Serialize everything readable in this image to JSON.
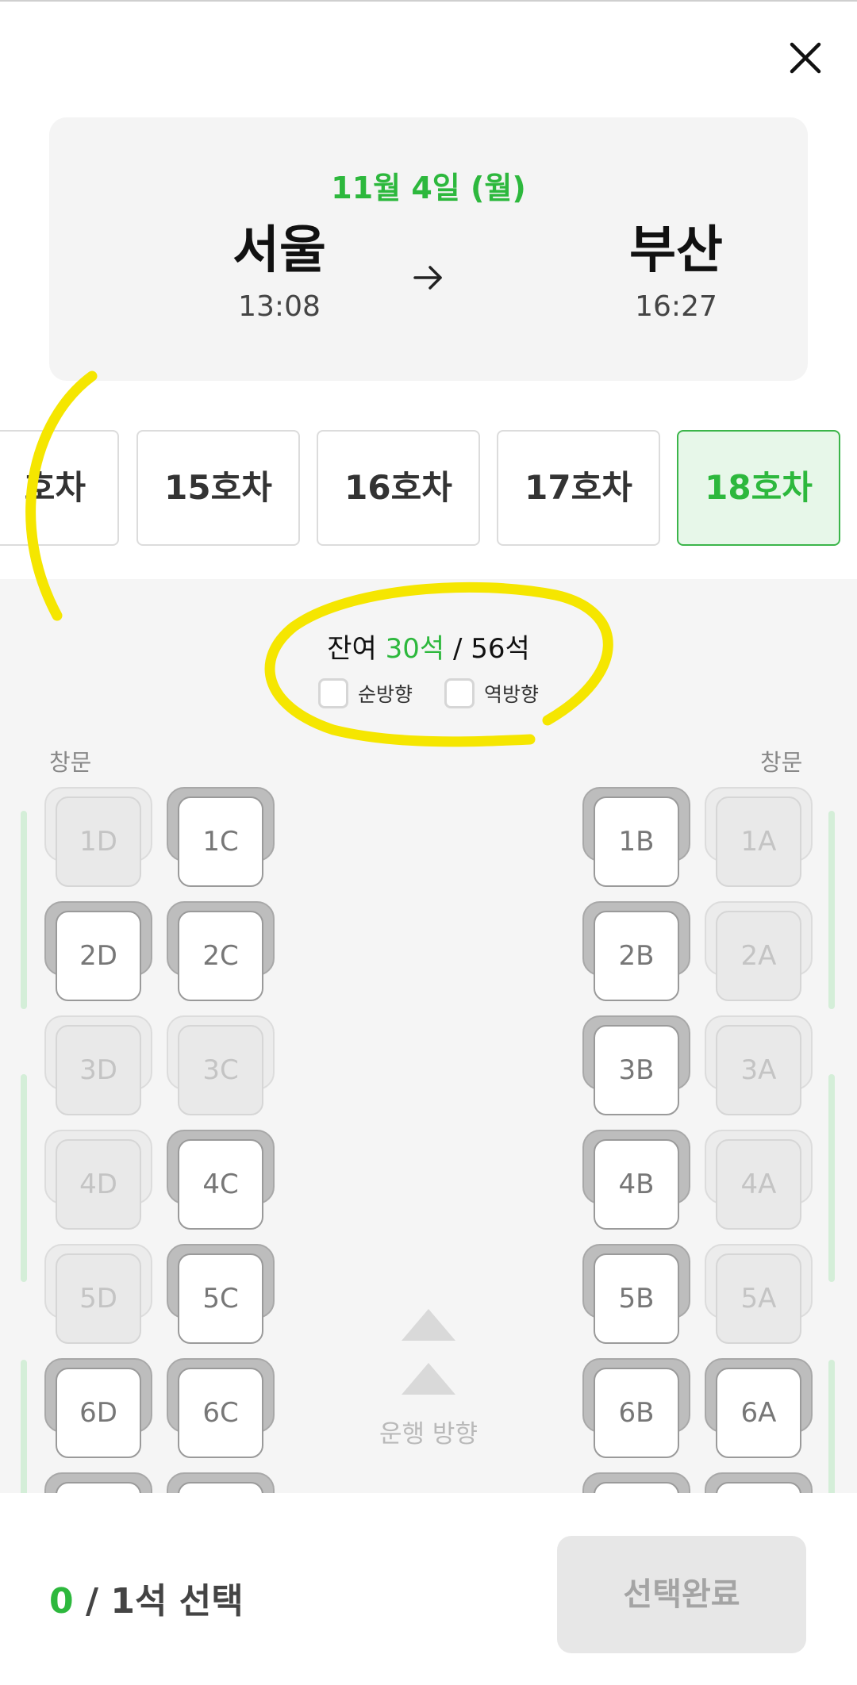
{
  "trip": {
    "date": "11월 4일 (월)",
    "departure": {
      "station": "서울",
      "time": "13:08"
    },
    "arrival": {
      "station": "부산",
      "time": "16:27"
    }
  },
  "cars": [
    {
      "label": "호차",
      "state": "partial"
    },
    {
      "label": "15호차",
      "state": "normal"
    },
    {
      "label": "16호차",
      "state": "normal"
    },
    {
      "label": "17호차",
      "state": "normal"
    },
    {
      "label": "18호차",
      "state": "active"
    }
  ],
  "seat_summary": {
    "prefix": "잔여",
    "remaining": "30석",
    "separator": "/",
    "total": "56석"
  },
  "filters": {
    "forward": "순방향",
    "backward": "역방향"
  },
  "window_label": "창문",
  "travel_direction": "운행 방향",
  "seats": {
    "row1": {
      "1D": "taken",
      "1C": "open",
      "1B": "open",
      "1A": "taken"
    },
    "row2": {
      "2D": "open",
      "2C": "open",
      "2B": "open",
      "2A": "taken"
    },
    "row3": {
      "3D": "taken",
      "3C": "taken",
      "3B": "open",
      "3A": "taken"
    },
    "row4": {
      "4D": "taken",
      "4C": "open",
      "4B": "open",
      "4A": "taken"
    },
    "row5": {
      "5D": "taken",
      "5C": "open",
      "5B": "open",
      "5A": "taken"
    },
    "row6": {
      "6D": "open",
      "6C": "open",
      "6B": "open",
      "6A": "open"
    }
  },
  "selection": {
    "count": "0",
    "suffix": "/ 1석 선택"
  },
  "done_button": "선택완료",
  "colors": {
    "accent": "#2db83d",
    "active_tab_bg": "#e7f7e9",
    "annotation": "#f5e600"
  }
}
